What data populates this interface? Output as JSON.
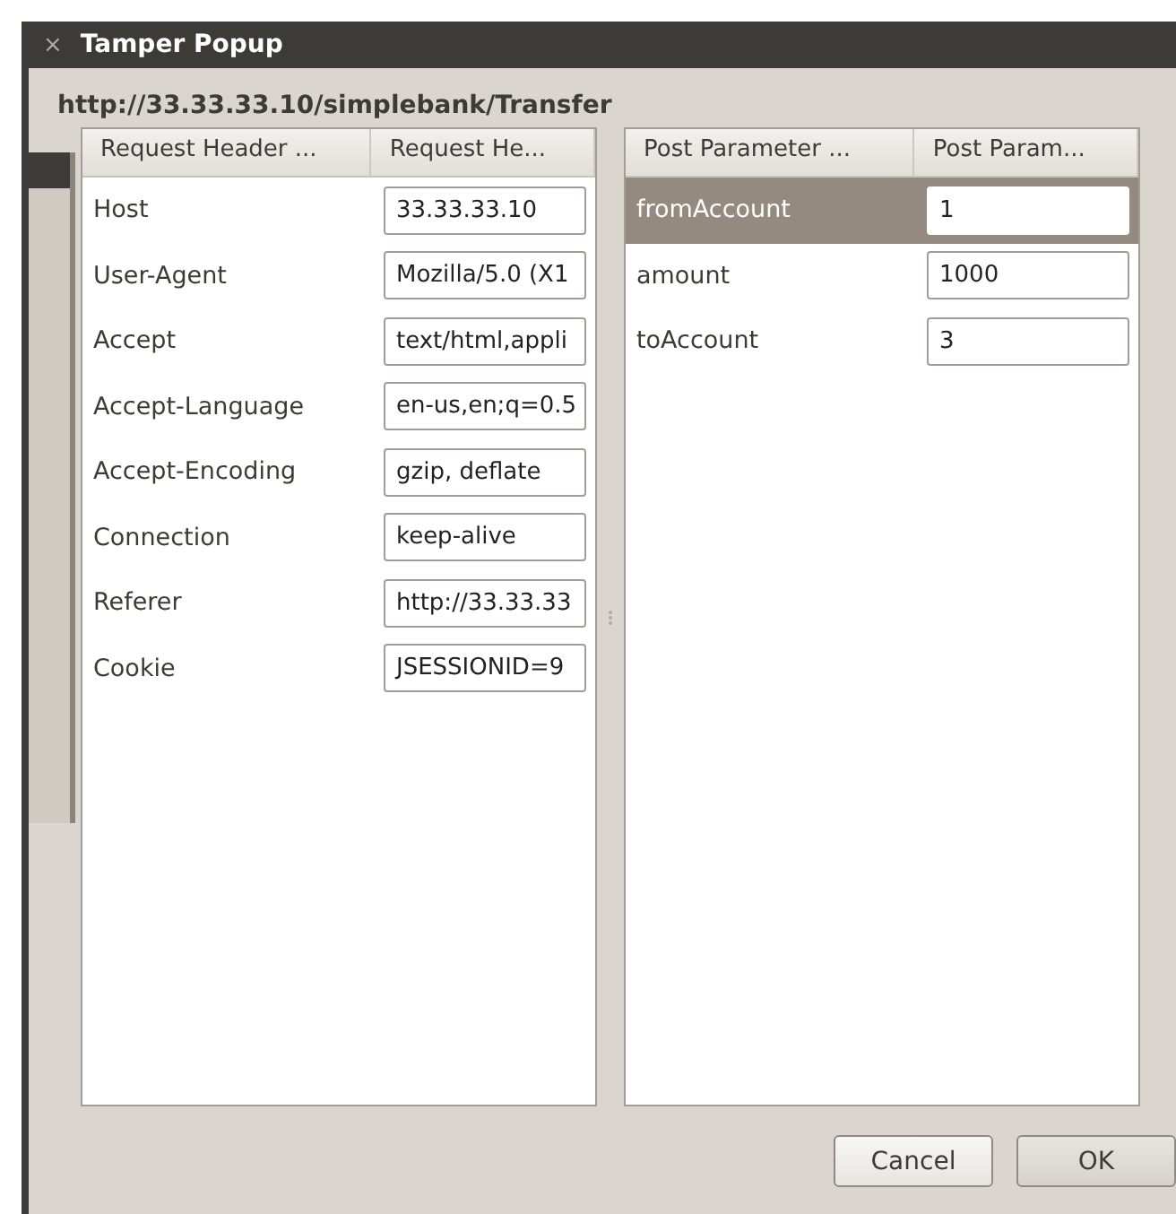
{
  "window": {
    "title": "Tamper Popup",
    "close": "×"
  },
  "url": "http://33.33.33.10/simplebank/Transfer",
  "headers_table": {
    "columns": [
      "Request Header ...",
      "Request He..."
    ],
    "rows": [
      {
        "name": "Host",
        "value": "33.33.33.10"
      },
      {
        "name": "User-Agent",
        "value": "Mozilla/5.0 (X1"
      },
      {
        "name": "Accept",
        "value": "text/html,appli"
      },
      {
        "name": "Accept-Language",
        "value": "en-us,en;q=0.5"
      },
      {
        "name": "Accept-Encoding",
        "value": "gzip, deflate"
      },
      {
        "name": "Connection",
        "value": "keep-alive"
      },
      {
        "name": "Referer",
        "value": "http://33.33.33"
      },
      {
        "name": "Cookie",
        "value": "JSESSIONID=9"
      }
    ]
  },
  "params_table": {
    "columns": [
      "Post Parameter ...",
      "Post Param..."
    ],
    "rows": [
      {
        "name": "fromAccount",
        "value": "1",
        "selected": true
      },
      {
        "name": "amount",
        "value": "1000",
        "selected": false
      },
      {
        "name": "toAccount",
        "value": "3",
        "selected": false
      }
    ]
  },
  "buttons": [
    "Cancel",
    "OK"
  ]
}
